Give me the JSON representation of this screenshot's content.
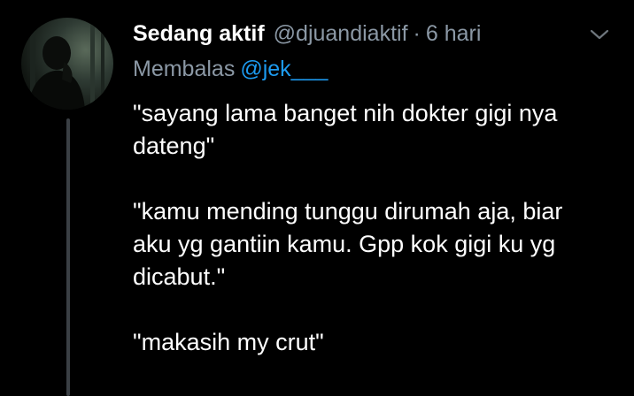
{
  "tweet": {
    "display_name": "Sedang aktif",
    "handle": "@djuandiaktif",
    "separator": "·",
    "time": "6 hari",
    "replying_label": "Membalas",
    "replying_to": "@jek___",
    "body_lines": [
      [
        "\"sayang lama banget nih dokter gigi nya",
        "dateng\""
      ],
      [
        "\"kamu mending tunggu dirumah aja, biar",
        "aku yg gantiin kamu. Gpp kok gigi ku yg",
        "dicabut.\""
      ],
      [
        "\"makasih my crut\""
      ]
    ]
  },
  "icons": {
    "avatar": "profile-photo",
    "caret": "chevron-down-icon"
  },
  "colors": {
    "background": "#000000",
    "text": "#ffffff",
    "secondary": "#8b98a5",
    "link": "#1d9bf0",
    "thread_line": "#3a3f44"
  }
}
